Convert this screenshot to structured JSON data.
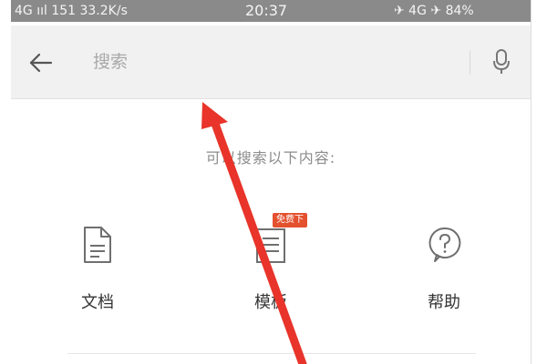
{
  "status_bar": {
    "left_text": "4G ııl  151  33.2K/s",
    "time": "20:37",
    "right_text": "✈ 4G ✈ 84%"
  },
  "search": {
    "placeholder": "搜索"
  },
  "icons": {
    "back": "arrow-left-icon",
    "mic": "microphone-icon",
    "document": "document-icon",
    "template": "template-icon",
    "help": "question-circle-icon"
  },
  "hint": "可以搜索以下内容:",
  "categories": [
    {
      "label": "文档"
    },
    {
      "label": "模板",
      "badge": "免费下"
    },
    {
      "label": "帮助"
    }
  ],
  "colors": {
    "status_bar": "#8a8a8a",
    "search_bar": "#f1f1f1",
    "badge": "#e4512f",
    "annotation_arrow": "#e8342a"
  }
}
